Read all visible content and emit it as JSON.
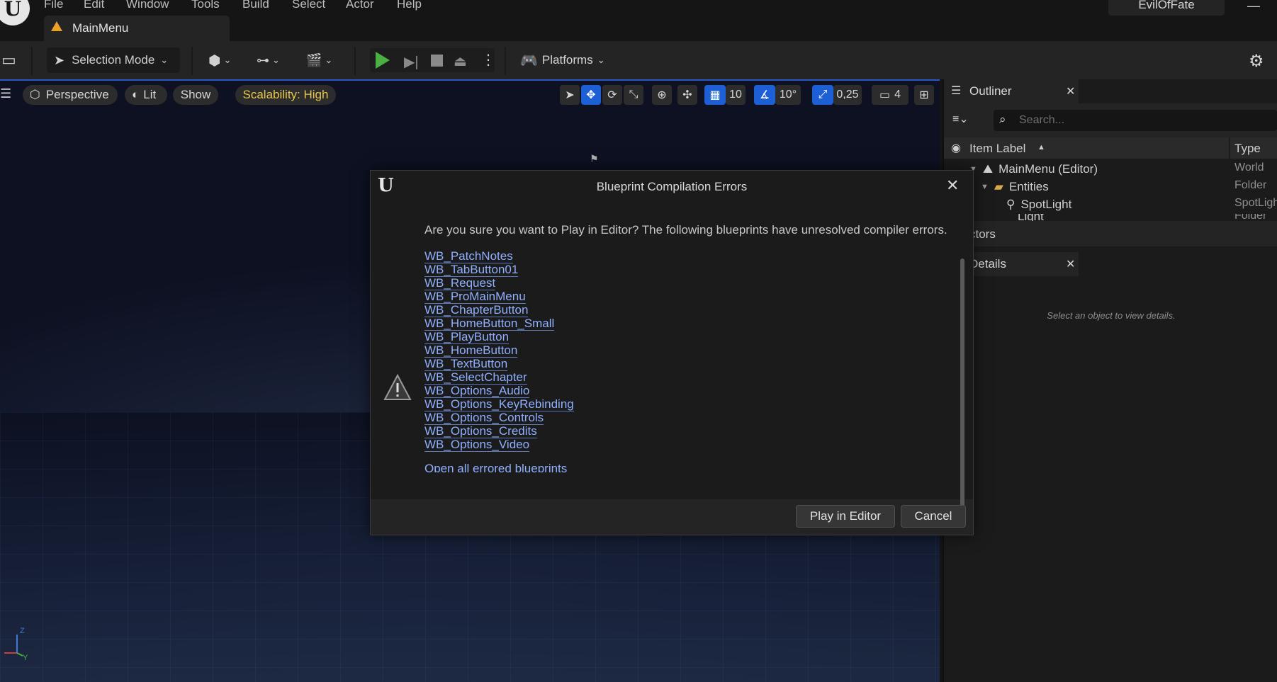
{
  "menu": {
    "items": [
      "File",
      "Edit",
      "Window",
      "Tools",
      "Build",
      "Select",
      "Actor",
      "Help"
    ],
    "project_name": "EvilOfFate"
  },
  "tab": {
    "label": "MainMenu"
  },
  "toolbar": {
    "selection_mode": "Selection Mode",
    "platforms": "Platforms"
  },
  "viewport": {
    "perspective": "Perspective",
    "lit": "Lit",
    "show": "Show",
    "scalability": "Scalability: High",
    "grid_snap": "10",
    "rotation_snap": "10°",
    "scale_snap": "0,25",
    "camera_speed": "4",
    "axis_z": "Z",
    "axis_y": "Y"
  },
  "outliner": {
    "title": "Outliner",
    "search_placeholder": "Search...",
    "col_label": "Item Label",
    "col_type": "Type",
    "rows": [
      {
        "label": "MainMenu (Editor)",
        "type": "World"
      },
      {
        "label": "Entities",
        "type": "Folder"
      },
      {
        "label": "SpotLight",
        "type": "SpotLigh"
      },
      {
        "label": "Light",
        "type": "Folder"
      }
    ],
    "actors_label": "ctors"
  },
  "details": {
    "title": "Details",
    "empty_text": "Select an object to view details."
  },
  "dialog": {
    "title": "Blueprint Compilation Errors",
    "message": "Are you sure you want to Play in Editor? The following blueprints have unresolved compiler errors.",
    "blueprints": [
      "WB_PatchNotes",
      "WB_TabButton01",
      "WB_Request",
      "WB_ProMainMenu",
      "WB_ChapterButton",
      "WB_HomeButton_Small",
      "WB_PlayButton",
      "WB_HomeButton",
      "WB_TextButton",
      "WB_SelectChapter",
      "WB_Options_Audio",
      "WB_Options_KeyRebinding",
      "WB_Options_Controls",
      "WB_Options_Credits",
      "WB_Options_Video"
    ],
    "open_all": "Open all errored blueprints",
    "play_button": "Play in Editor",
    "cancel_button": "Cancel"
  },
  "colors": {
    "accent_blue": "#1d60d6",
    "play_green": "#49b041",
    "scalability_yellow": "#e8c84a",
    "link_blue": "#8fb0ff"
  }
}
